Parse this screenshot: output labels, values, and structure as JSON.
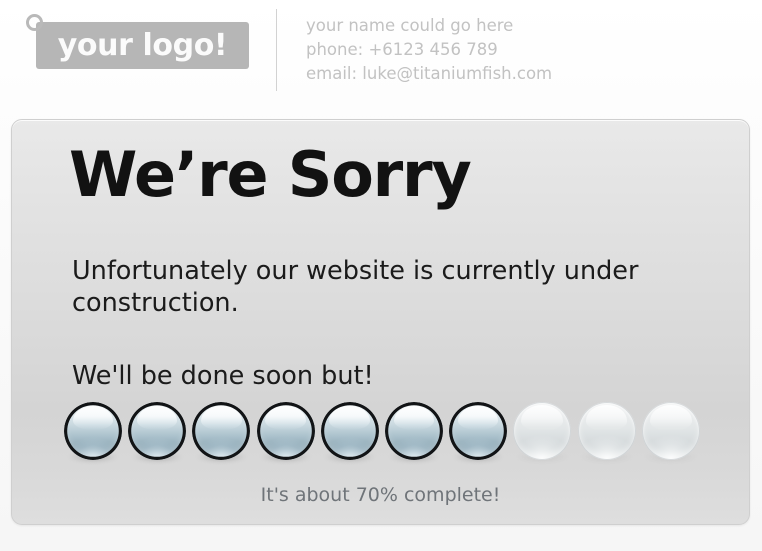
{
  "header": {
    "logo": {
      "text": "your logo!",
      "plate_color": "#b6b6b6",
      "text_color": "#fbfbfb"
    },
    "contact": {
      "name_line": "your name could go here",
      "phone_line": "phone: +6123 456 789",
      "email_line": "email: luke@titaniumfish.com",
      "text_color": "#c2c2c2"
    }
  },
  "panel": {
    "title": "We’re Sorry",
    "body_line_1": "Unfortunately our website is currently under construction.",
    "body_line_2": "We'll be done soon but!",
    "status": "It's about 70% complete!",
    "status_color": "#6f7479",
    "progress": {
      "total": 10,
      "filled": 7,
      "percent": 70,
      "filled_color": "#8ba5b2",
      "empty_color": "#dfe3e4",
      "orbs": [
        {
          "state": "filled"
        },
        {
          "state": "filled"
        },
        {
          "state": "filled"
        },
        {
          "state": "filled"
        },
        {
          "state": "filled"
        },
        {
          "state": "filled"
        },
        {
          "state": "filled"
        },
        {
          "state": "empty"
        },
        {
          "state": "empty"
        },
        {
          "state": "empty"
        }
      ]
    }
  }
}
